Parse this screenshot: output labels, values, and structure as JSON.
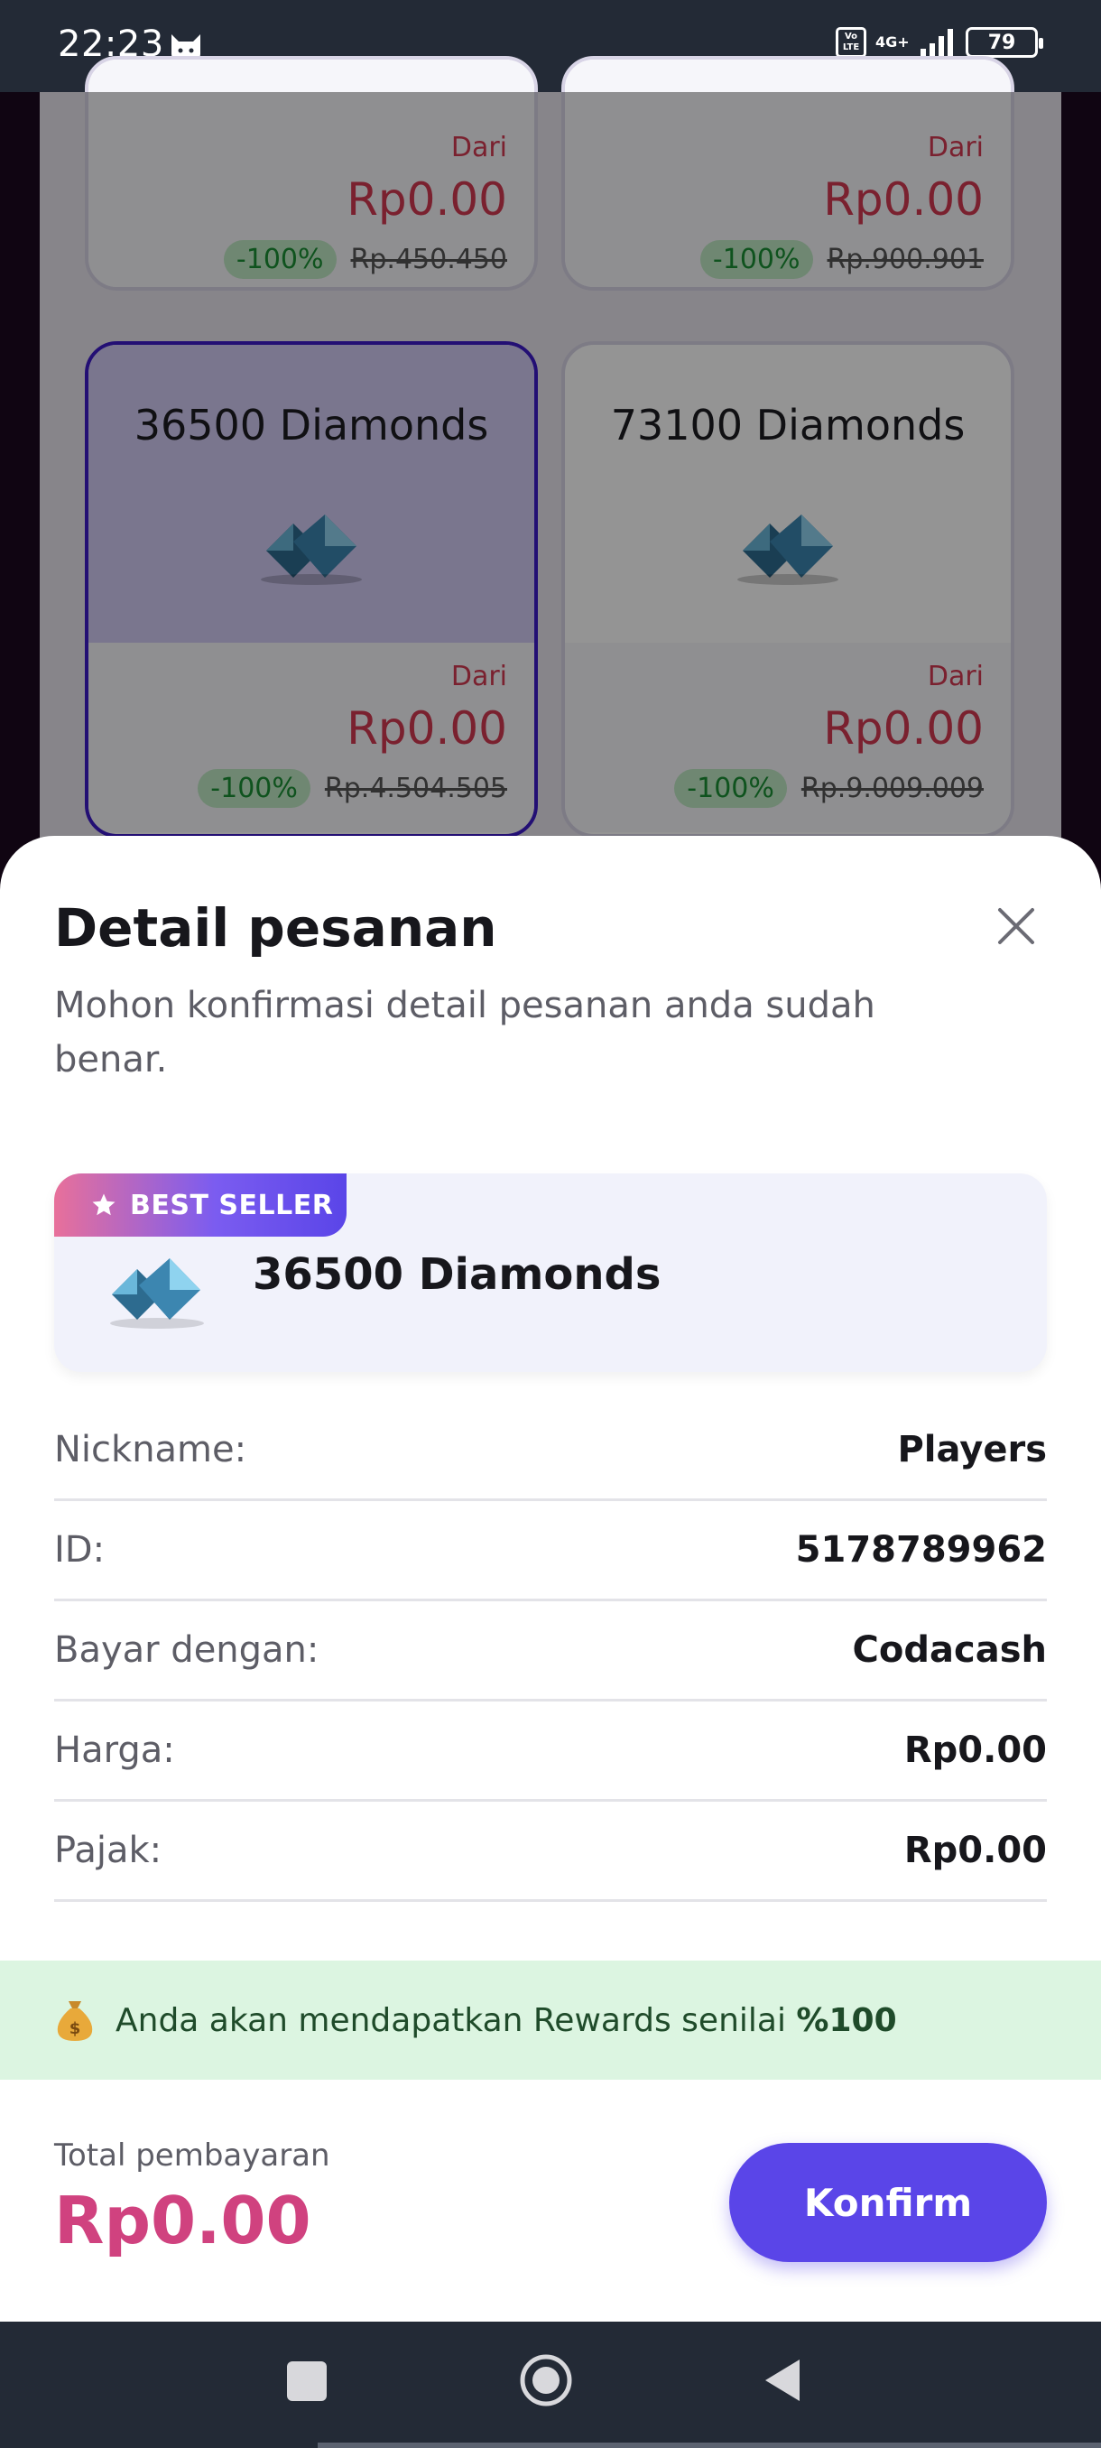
{
  "status_bar": {
    "time": "22:23",
    "volte": "Vo LTE",
    "network": "4G+",
    "battery": "79"
  },
  "background_cards": [
    {
      "title": "",
      "from": "Dari",
      "price": "Rp0.00",
      "discount": "-100%",
      "original": "Rp.450.450",
      "selected": false
    },
    {
      "title": "",
      "from": "Dari",
      "price": "Rp0.00",
      "discount": "-100%",
      "original": "Rp.900.901",
      "selected": false
    },
    {
      "title": "36500 Diamonds",
      "from": "Dari",
      "price": "Rp0.00",
      "discount": "-100%",
      "original": "Rp.4.504.505",
      "selected": true
    },
    {
      "title": "73100 Diamonds",
      "from": "Dari",
      "price": "Rp0.00",
      "discount": "-100%",
      "original": "Rp.9.009.009",
      "selected": false
    }
  ],
  "sheet": {
    "title": "Detail pesanan",
    "subtitle": "Mohon konfirmasi detail pesanan anda sudah benar.",
    "product": {
      "badge": "BEST SELLER",
      "name": "36500 Diamonds"
    },
    "rows": [
      {
        "label": "Nickname:",
        "value": "Players"
      },
      {
        "label": "ID:",
        "value": "5178789962"
      },
      {
        "label": "Bayar dengan:",
        "value": "Codacash"
      },
      {
        "label": "Harga:",
        "value": "Rp0.00"
      },
      {
        "label": "Pajak:",
        "value": "Rp0.00"
      }
    ],
    "rewards": {
      "text": "Anda akan mendapatkan Rewards senilai",
      "amount": "%100"
    },
    "total": {
      "label": "Total pembayaran",
      "value": "Rp0.00"
    },
    "confirm_label": "Konfirm"
  },
  "colors": {
    "accent": "#5a45e8",
    "total": "#d0427f",
    "price": "#d23a52",
    "rewards_bg": "#dcf5e1"
  }
}
